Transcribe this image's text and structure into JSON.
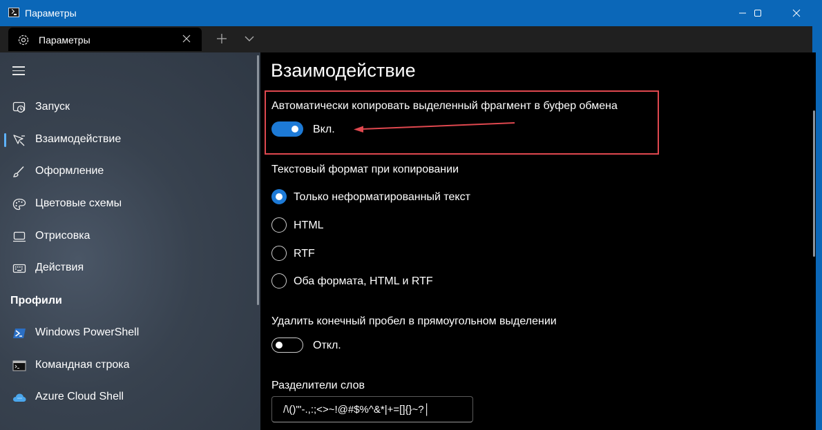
{
  "window": {
    "title": "Параметры"
  },
  "tabs": {
    "active_label": "Параметры",
    "new_tab_icon": "plus-icon",
    "dropdown_icon": "chevron-down-icon"
  },
  "sidebar": {
    "items": [
      {
        "label": "Запуск",
        "icon": "startup-icon"
      },
      {
        "label": "Взаимодействие",
        "icon": "interaction-icon",
        "selected": true
      },
      {
        "label": "Оформление",
        "icon": "brush-icon"
      },
      {
        "label": "Цветовые схемы",
        "icon": "palette-icon"
      },
      {
        "label": "Отрисовка",
        "icon": "monitor-icon"
      },
      {
        "label": "Действия",
        "icon": "keyboard-icon"
      }
    ],
    "profiles_heading": "Профили",
    "profiles": [
      {
        "label": "Windows PowerShell",
        "icon": "powershell-icon"
      },
      {
        "label": "Командная строка",
        "icon": "cmd-icon"
      },
      {
        "label": "Azure Cloud Shell",
        "icon": "azure-cloud-icon"
      }
    ]
  },
  "main": {
    "title": "Взаимодействие",
    "copy_on_select": {
      "label": "Автоматически копировать выделенный фрагмент в буфер обмена",
      "state_label": "Вкл.",
      "on": true
    },
    "copy_format": {
      "label": "Текстовый формат при копировании",
      "options": [
        {
          "label": "Только неформатированный текст",
          "checked": true
        },
        {
          "label": "HTML",
          "checked": false
        },
        {
          "label": "RTF",
          "checked": false
        },
        {
          "label": "Оба формата, HTML и RTF",
          "checked": false
        }
      ]
    },
    "trim_block_selection": {
      "label": "Удалить конечный пробел в прямоугольном выделении",
      "state_label": "Откл.",
      "on": false
    },
    "word_delimiters": {
      "label": "Разделители слов",
      "value": "/\\()\"'-.,:;<>~!@#$%^&*|+=[]{}~?│"
    }
  },
  "colors": {
    "accent": "#1d7ad6",
    "titlebar": "#0b67b8",
    "highlight": "#e0484f"
  }
}
